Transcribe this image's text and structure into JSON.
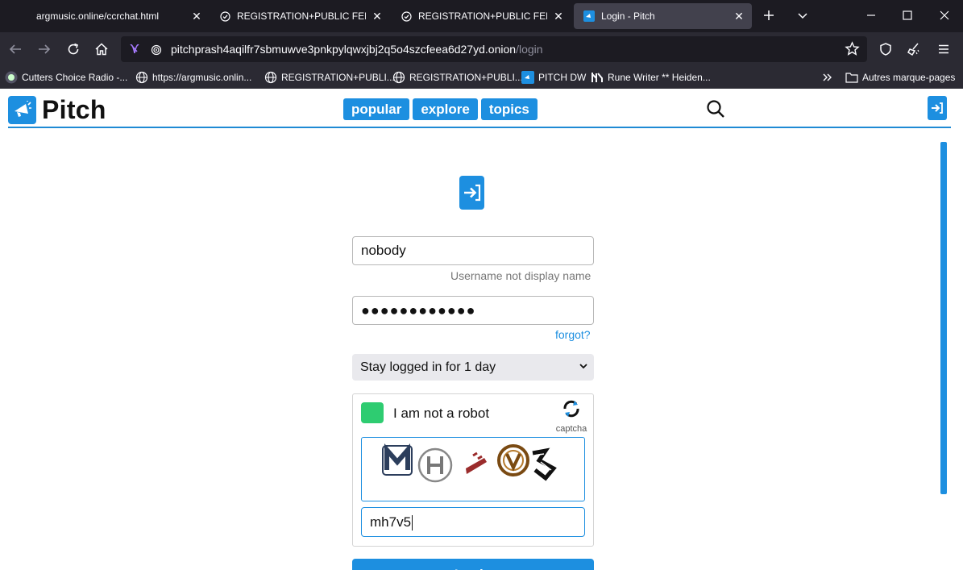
{
  "browser": {
    "tabs": [
      {
        "title": "argmusic.online/ccrchat.html",
        "active": false
      },
      {
        "title": "REGISTRATION+PUBLIC FEED -",
        "active": false
      },
      {
        "title": "REGISTRATION+PUBLIC FEED -",
        "active": false
      },
      {
        "title": "Login - Pitch",
        "active": true
      }
    ],
    "url": {
      "host": "pitchprash4aqilfr7sbmuwve3pnkpylqwxjbj2q5o4szcfeea6d27yd.onion",
      "path": "/login"
    },
    "bookmarks": [
      {
        "label": "Cutters Choice Radio -...",
        "icon": "radio-icon"
      },
      {
        "label": "https://argmusic.onlin...",
        "icon": "globe-icon"
      },
      {
        "label": "REGISTRATION+PUBLI...",
        "icon": "globe-icon"
      },
      {
        "label": "REGISTRATION+PUBLI...",
        "icon": "globe-icon"
      },
      {
        "label": "PITCH DW",
        "icon": "pitch-icon"
      },
      {
        "label": "Rune Writer ** Heiden...",
        "icon": "rune-icon"
      }
    ],
    "other_bookmarks": "Autres marque-pages"
  },
  "site": {
    "name": "Pitch",
    "nav": [
      "popular",
      "explore",
      "topics"
    ]
  },
  "login_form": {
    "username_value": "nobody",
    "username_hint": "Username not display name",
    "password_value": "●●●●●●●●●●●●",
    "forgot_label": "forgot?",
    "stay_logged_in": "Stay logged in for 1 day",
    "captcha": {
      "label": "I am not a robot",
      "brand": "captcha",
      "input_value": "mh7v5"
    },
    "submit_label": "Login"
  },
  "colors": {
    "accent": "#1d8fe0",
    "captcha_check": "#2ecc71",
    "chrome_dark": "#1c1b22",
    "chrome_toolbar": "#2b2a33"
  }
}
